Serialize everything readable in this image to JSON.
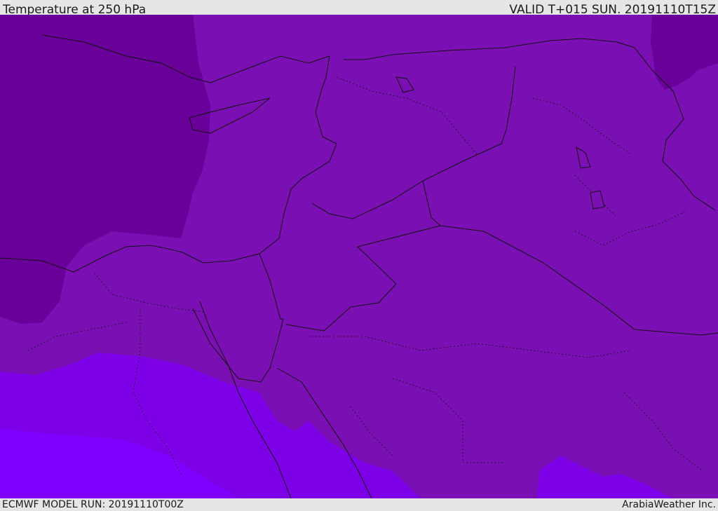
{
  "header": {
    "title": "Temperature at 250 hPa",
    "valid_time": "VALID T+015 SUN. 20191110T15Z"
  },
  "footer": {
    "model_run": "ECMWF MODEL RUN: 20191110T00Z",
    "credit": "ArabiaWeather Inc."
  },
  "colors": {
    "band_coldest": "#680099",
    "band_cold": "#7a10b3",
    "band_mid": "#7e00e6",
    "band_warm": "#8000ff",
    "border": "#111111",
    "bar": "#e6e6e6"
  }
}
